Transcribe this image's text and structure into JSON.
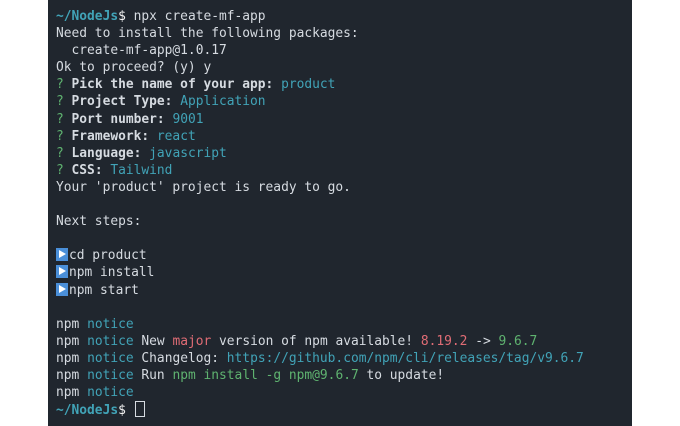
{
  "terminal": {
    "prompt_path": "~/NodeJs",
    "prompt_symbol": "$",
    "command": " npx create-mf-app",
    "install_msg": "Need to install the following packages:",
    "package": "  create-mf-app@1.0.17",
    "proceed": "Ok to proceed? (y) y",
    "questions": [
      {
        "mark": "?",
        "label": "Pick the name of your app:",
        "answer": "product"
      },
      {
        "mark": "?",
        "label": "Project Type:",
        "answer": "Application"
      },
      {
        "mark": "?",
        "label": "Port number:",
        "answer": "9001"
      },
      {
        "mark": "?",
        "label": "Framework:",
        "answer": "react"
      },
      {
        "mark": "?",
        "label": "Language:",
        "answer": "javascript"
      },
      {
        "mark": "?",
        "label": "CSS:",
        "answer": "Tailwind"
      }
    ],
    "ready": "Your 'product' project is ready to go.",
    "next_steps": "Next steps:",
    "steps": [
      "cd product",
      "npm install",
      "npm start"
    ],
    "npm": {
      "prefix": "npm",
      "notice": "notice",
      "new_pre": "New",
      "major": "major",
      "version_text": "version of npm available!",
      "old_version": "8.19.2",
      "arrow": "->",
      "new_version": "9.6.7",
      "changelog_label": "Changelog:",
      "changelog_url": "https://github.com/npm/cli/releases/tag/v9.6.7",
      "run_label": "Run",
      "run_cmd": "npm install -g npm@9.6.7",
      "run_suffix": "to update!"
    }
  },
  "colors": {
    "background": "#20262e",
    "text": "#d6dbe1",
    "green": "#5fb370",
    "cyan": "#41a3b7",
    "red": "#e06c75",
    "step_icon": "#4a8fd9"
  },
  "icons": {
    "step": "play-arrow-icon",
    "cursor": "block-cursor-icon"
  }
}
